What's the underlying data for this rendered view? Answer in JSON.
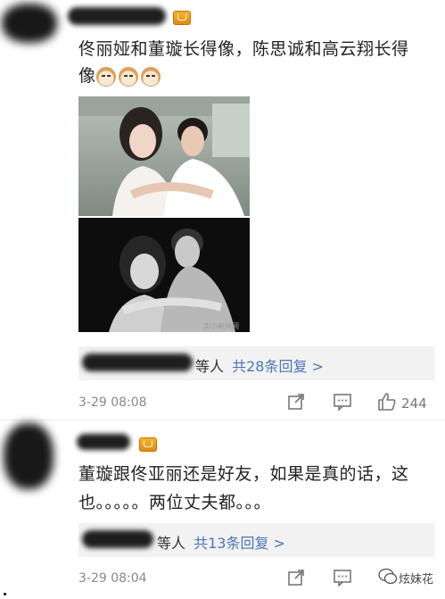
{
  "comments": [
    {
      "lines": [
        "佟丽娅和董璇长得像，陈思诚和高云翔长得",
        "像"
      ],
      "emoji_count": 3,
      "reply_suffix": "等人",
      "reply_count": "共28条回复 >",
      "timestamp": "3-29 08:08",
      "likes": "244"
    },
    {
      "lines": [
        "董璇跟佟亚丽还是好友，如果是真的话，这",
        "也。。。。。两位丈夫都。。。"
      ],
      "reply_suffix": "等人",
      "reply_count": "共13条回复 >",
      "timestamp": "3-29 08:04",
      "likes": ""
    }
  ],
  "photo_watermark": "实小新闻网",
  "corner_watermark": "炫妹花",
  "icons": {
    "vip": "crown-icon",
    "share": "share-icon",
    "comment": "comment-icon",
    "like": "thumbs-up-icon"
  },
  "colors": {
    "reply_link": "#4a76b8",
    "meta_text": "#888888",
    "reply_bg": "#f2f2f2"
  }
}
